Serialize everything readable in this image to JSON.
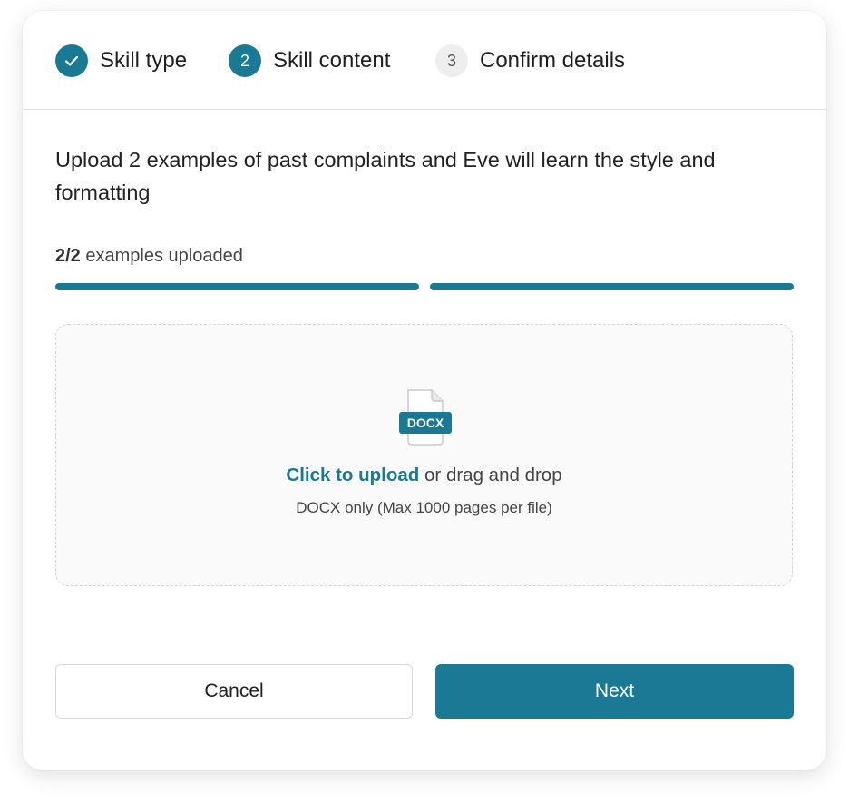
{
  "stepper": {
    "steps": [
      {
        "label": "Skill type",
        "number": "",
        "status": "done"
      },
      {
        "label": "Skill content",
        "number": "2",
        "status": "active"
      },
      {
        "label": "Confirm details",
        "number": "3",
        "status": "pending"
      }
    ]
  },
  "instruction": "Upload 2 examples of past complaints and Eve will learn the style and formatting",
  "progress": {
    "count": "2/2",
    "suffix": " examples uploaded",
    "segments": [
      {
        "filled": 1.0
      },
      {
        "filled": 1.0
      }
    ]
  },
  "dropzone": {
    "file_type_label": "DOCX",
    "icon": "docx-file-icon",
    "click_label": "Click to upload",
    "drag_text": " or drag and drop",
    "hint": "DOCX only (Max 1000 pages per file)"
  },
  "buttons": {
    "cancel": "Cancel",
    "next": "Next"
  },
  "colors": {
    "accent": "#1a7a96",
    "pending_step": "#eeeeee",
    "border": "#e3e3e3"
  }
}
